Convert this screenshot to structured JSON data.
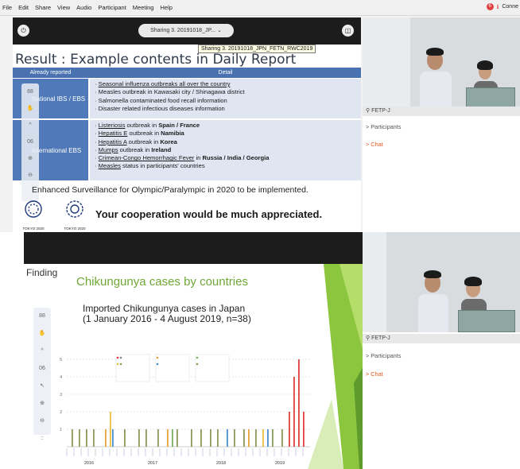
{
  "menubar": {
    "items": [
      "File",
      "Edit",
      "Share",
      "View",
      "Audio",
      "Participant",
      "Meeting",
      "Help"
    ],
    "rec_badge": "6",
    "status": "Conne"
  },
  "share": {
    "pill_label": "Sharing 3. 20191018_JP...",
    "tooltip": "Sharing 3. 20191018_JPN_FETN_RWC2019",
    "title": "Result : Example contents in Daily Report",
    "col_left": "Already reported",
    "col_right": "Detail",
    "row1_label": "National IBS / EBS",
    "row1_items": [
      "Seasonal influenza outbreaks all over the country",
      "Measles outbreak in Kawasaki city / Shinagawa district",
      "Salmonella contaminated food recall information",
      "Disaster related infectious diseases information"
    ],
    "row2_label": "International EBS",
    "row2_items": [
      {
        "pre": "Listeriosis",
        "mid": " outbreak in ",
        "bold": "Spain / France"
      },
      {
        "pre": "Hepatitis E",
        "mid": " outbreak in ",
        "bold": "Namibia"
      },
      {
        "pre": "Hepatitis A",
        "mid": " outbreak in ",
        "bold": "Korea"
      },
      {
        "pre": "Mumps",
        "mid": " outbreak in ",
        "bold": "Ireland"
      },
      {
        "pre": "Crimean-Congo Hemorrhagic Fever",
        "mid": " in ",
        "bold": "Russia / India / Georgia"
      },
      {
        "pre": "Measles",
        "mid": " status in participants' countries",
        "bold": ""
      }
    ],
    "enhanced": "Enhanced Surveillance for Olympic/Paralympic in 2020 to be implemented.",
    "cooperation": "Your cooperation would be much appreciated.",
    "logo1_text": "TOKYO 2020",
    "logo2_text": "TOKYO 2020",
    "tools": [
      "88",
      "✋",
      "^",
      "06",
      "⊕",
      "⊖"
    ]
  },
  "top_panel": {
    "name": "FETP-J",
    "participants": "Participants",
    "chat": "Chat"
  },
  "bottom_panel": {
    "name": "FETP-J",
    "participants": "Participants",
    "chat": "Chat"
  },
  "pres": {
    "finding": "Finding",
    "title": "Chikungunya cases by countries",
    "subtitle_line1": "Imported Chikungunya cases in Japan",
    "subtitle_line2": "(1 January 2016 - 4 August 2019, n=38)",
    "tools": [
      "88",
      "✋",
      "^",
      "06",
      "↖",
      "⊕",
      "⊖",
      "::"
    ]
  },
  "chart_data": {
    "type": "bar",
    "title": "Imported Chikungunya cases in Japan",
    "subtitle": "(1 January 2016 - 4 August 2019, n=38)",
    "y_ticks": [
      "5",
      "4",
      "3",
      "2",
      "1"
    ],
    "ylim": [
      0,
      5
    ],
    "year_labels": [
      "2016",
      "2017",
      "2018",
      "2019"
    ],
    "bars": [
      {
        "i": 2,
        "v": 1,
        "c": "#8a9a5b"
      },
      {
        "i": 5,
        "v": 1,
        "c": "#8a9a5b"
      },
      {
        "i": 8,
        "v": 1,
        "c": "#8a9a5b"
      },
      {
        "i": 11,
        "v": 1,
        "c": "#8a9a5b"
      },
      {
        "i": 16,
        "v": 1,
        "c": "#e8a33c"
      },
      {
        "i": 18,
        "v": 2,
        "c": "#e8c03c"
      },
      {
        "i": 19,
        "v": 1,
        "c": "#4a90d0"
      },
      {
        "i": 24,
        "v": 1,
        "c": "#8a9a5b"
      },
      {
        "i": 30,
        "v": 1,
        "c": "#8a9a5b"
      },
      {
        "i": 33,
        "v": 1,
        "c": "#8a9a5b"
      },
      {
        "i": 38,
        "v": 1,
        "c": "#8a9a5b"
      },
      {
        "i": 42,
        "v": 1,
        "c": "#e8a33c"
      },
      {
        "i": 44,
        "v": 1,
        "c": "#7ab06a"
      },
      {
        "i": 46,
        "v": 1,
        "c": "#8a9a5b"
      },
      {
        "i": 52,
        "v": 1,
        "c": "#8a9a5b"
      },
      {
        "i": 56,
        "v": 1,
        "c": "#8a9a5b"
      },
      {
        "i": 60,
        "v": 1,
        "c": "#8a9a5b"
      },
      {
        "i": 63,
        "v": 1,
        "c": "#8a9a5b"
      },
      {
        "i": 67,
        "v": 1,
        "c": "#4a90d0"
      },
      {
        "i": 70,
        "v": 1,
        "c": "#8a9a5b"
      },
      {
        "i": 74,
        "v": 1,
        "c": "#8a9a5b"
      },
      {
        "i": 76,
        "v": 1,
        "c": "#e8a33c"
      },
      {
        "i": 79,
        "v": 1,
        "c": "#8a9a5b"
      },
      {
        "i": 82,
        "v": 1,
        "c": "#e8c03c"
      },
      {
        "i": 84,
        "v": 1,
        "c": "#4a90d0"
      },
      {
        "i": 86,
        "v": 1,
        "c": "#8a9a5b"
      },
      {
        "i": 90,
        "v": 1,
        "c": "#8a9a5b"
      },
      {
        "i": 93,
        "v": 2,
        "c": "#e04040"
      },
      {
        "i": 95,
        "v": 4,
        "c": "#e04040"
      },
      {
        "i": 97,
        "v": 5,
        "c": "#e04040"
      },
      {
        "i": 99,
        "v": 2,
        "c": "#e04040"
      }
    ]
  }
}
